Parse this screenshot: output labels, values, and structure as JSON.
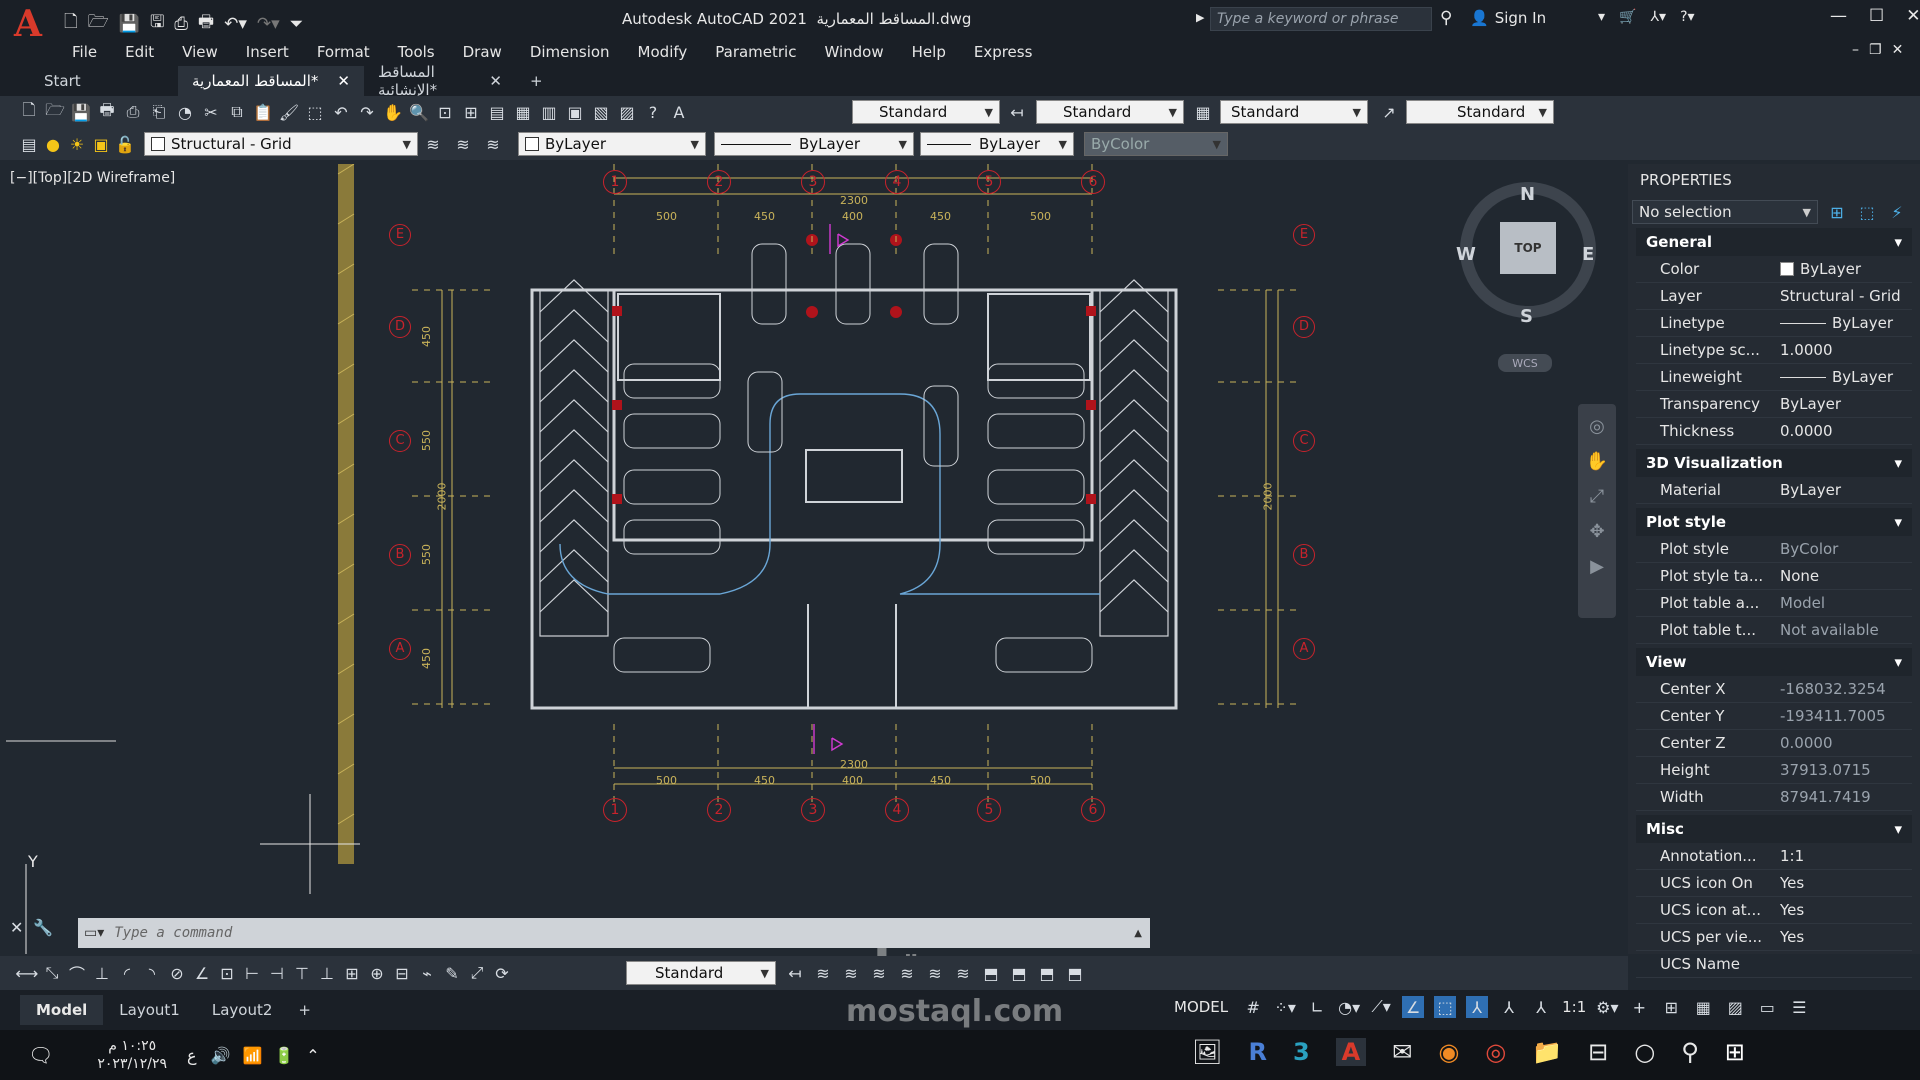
{
  "app": {
    "title": "Autodesk AutoCAD 2021",
    "filename": "المساقط المعمارية.dwg",
    "search_placeholder": "Type a keyword or phrase",
    "sign_in": "Sign In"
  },
  "menu": [
    "File",
    "Edit",
    "View",
    "Insert",
    "Format",
    "Tools",
    "Draw",
    "Dimension",
    "Modify",
    "Parametric",
    "Window",
    "Help",
    "Express"
  ],
  "tabs": [
    {
      "label": "Start"
    },
    {
      "label": "المساقط المعمارية*"
    },
    {
      "label": "المساقط الإنشائية*"
    }
  ],
  "styles": {
    "text_style": "Standard",
    "dim_style": "Standard",
    "table_style": "Standard",
    "mleader_style": "Standard"
  },
  "layers": {
    "current": "Structural - Grid",
    "color": "ByLayer",
    "linetype": "ByLayer",
    "lineweight": "ByLayer",
    "plotstyle": "ByColor"
  },
  "viewport": {
    "label": "[−][Top][2D Wireframe]",
    "compass": {
      "n": "N",
      "s": "S",
      "e": "E",
      "w": "W",
      "top": "TOP",
      "wcs": "WCS"
    }
  },
  "drawing": {
    "grid_cols": [
      "1",
      "2",
      "3",
      "4",
      "5",
      "6"
    ],
    "grid_rows": [
      "E",
      "D",
      "C",
      "B",
      "A"
    ],
    "col_dims": [
      "500",
      "450",
      "400",
      "450",
      "500"
    ],
    "total_width": "2300",
    "row_dims_left": [
      "450",
      "550",
      "550",
      "450"
    ],
    "total_height": "2000"
  },
  "properties": {
    "header": "PROPERTIES",
    "selection": "No selection",
    "sections": [
      {
        "title": "General",
        "rows": [
          {
            "k": "Color",
            "v": "ByLayer"
          },
          {
            "k": "Layer",
            "v": "Structural - Grid"
          },
          {
            "k": "Linetype",
            "v": "ByLayer"
          },
          {
            "k": "Linetype sc...",
            "v": "1.0000"
          },
          {
            "k": "Lineweight",
            "v": "ByLayer"
          },
          {
            "k": "Transparency",
            "v": "ByLayer"
          },
          {
            "k": "Thickness",
            "v": "0.0000"
          }
        ]
      },
      {
        "title": "3D Visualization",
        "rows": [
          {
            "k": "Material",
            "v": "ByLayer"
          }
        ]
      },
      {
        "title": "Plot style",
        "rows": [
          {
            "k": "Plot style",
            "v": "ByColor"
          },
          {
            "k": "Plot style ta...",
            "v": "None"
          },
          {
            "k": "Plot table a...",
            "v": "Model"
          },
          {
            "k": "Plot table t...",
            "v": "Not available"
          }
        ]
      },
      {
        "title": "View",
        "rows": [
          {
            "k": "Center X",
            "v": "-168032.3254"
          },
          {
            "k": "Center Y",
            "v": "-193411.7005"
          },
          {
            "k": "Center Z",
            "v": "0.0000"
          },
          {
            "k": "Height",
            "v": "37913.0715"
          },
          {
            "k": "Width",
            "v": "87941.7419"
          }
        ]
      },
      {
        "title": "Misc",
        "rows": [
          {
            "k": "Annotation...",
            "v": "1:1"
          },
          {
            "k": "UCS icon On",
            "v": "Yes"
          },
          {
            "k": "UCS icon at...",
            "v": "Yes"
          },
          {
            "k": "UCS per vie...",
            "v": "Yes"
          },
          {
            "k": "UCS Name",
            "v": ""
          }
        ]
      }
    ]
  },
  "command": {
    "placeholder": "Type a command"
  },
  "bottom_style": "Standard",
  "layout_tabs": [
    "Model",
    "Layout1",
    "Layout2"
  ],
  "status": {
    "model": "MODEL",
    "scale": "1:1"
  },
  "watermark": {
    "name": "مستقل",
    "url": "mostaql.com"
  },
  "taskbar": {
    "time": "١٠:٢٥ م",
    "date": "٢٠٢٣/١٢/٢٩",
    "lang": "ع"
  },
  "ucs": {
    "y": "Y"
  }
}
